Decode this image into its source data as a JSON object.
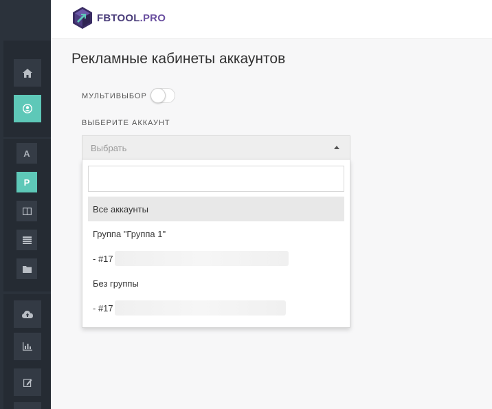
{
  "brand": {
    "name_main": "FBTOOL",
    "name_suffix": ".PRO",
    "icon": "cube-logo-icon"
  },
  "sidebar": {
    "primary": [
      {
        "id": "home",
        "icon": "home-icon",
        "active": false
      },
      {
        "id": "accounts",
        "icon": "user-circle-icon",
        "active": true
      }
    ],
    "secondary": [
      {
        "id": "a",
        "label": "A",
        "active": false
      },
      {
        "id": "p",
        "label": "P",
        "active": true
      },
      {
        "id": "columns",
        "icon": "columns-icon",
        "active": false
      },
      {
        "id": "list",
        "icon": "list-icon",
        "active": false
      },
      {
        "id": "folder",
        "icon": "folder-icon",
        "active": false
      }
    ],
    "tertiary": [
      {
        "id": "cloud",
        "icon": "cloud-upload-icon"
      },
      {
        "id": "stats",
        "icon": "bar-chart-icon"
      },
      {
        "id": "edit",
        "icon": "edit-icon"
      }
    ],
    "colors": {
      "bg": "#2b323b",
      "accent": "#5ec8b8"
    }
  },
  "main": {
    "title": "Рекламные кабинеты аккаунтов",
    "multiselect_label": "МУЛЬТИВЫБОР",
    "multiselect_on": false,
    "account_label": "ВЫБЕРИТЕ АККАУНТ",
    "select": {
      "placeholder": "Выбрать",
      "open": true,
      "search_value": "",
      "options": [
        {
          "text": "Все аккаунты",
          "highlighted": true
        },
        {
          "text": "Группа \"Группа 1\"",
          "highlighted": false
        },
        {
          "text": "- #17",
          "highlighted": false
        },
        {
          "text": "Без группы",
          "highlighted": false
        },
        {
          "text": "- #17",
          "highlighted": false
        }
      ]
    }
  }
}
